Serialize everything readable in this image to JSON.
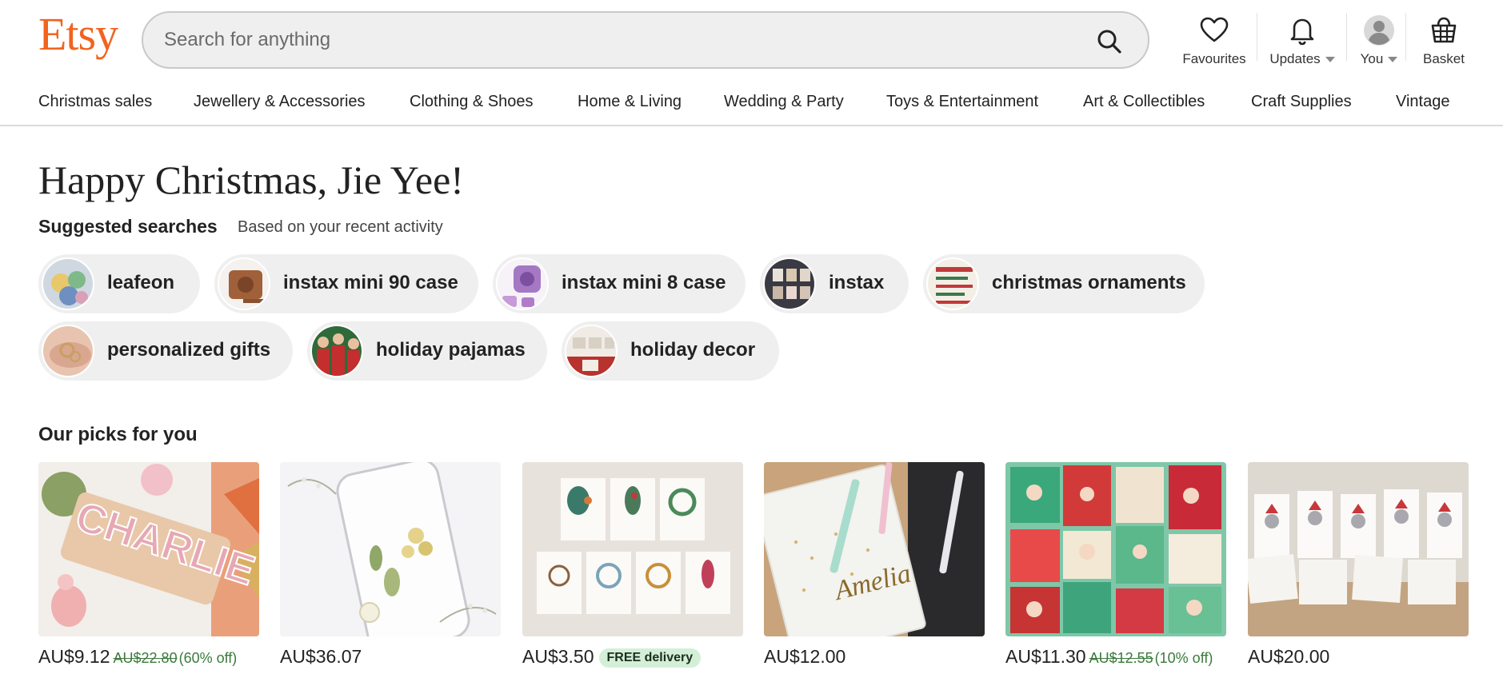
{
  "header": {
    "logo": "Etsy",
    "search_placeholder": "Search for anything",
    "favourites_label": "Favourites",
    "updates_label": "Updates",
    "you_label": "You",
    "basket_label": "Basket"
  },
  "categories": [
    "Christmas sales",
    "Jewellery & Accessories",
    "Clothing & Shoes",
    "Home & Living",
    "Wedding & Party",
    "Toys & Entertainment",
    "Art & Collectibles",
    "Craft Supplies",
    "Vintage"
  ],
  "greeting": "Happy Christmas, Jie Yee!",
  "suggested": {
    "title": "Suggested searches",
    "subtitle": "Based on your recent activity",
    "chips": [
      "leafeon",
      "instax mini 90 case",
      "instax mini 8 case",
      "instax",
      "christmas ornaments",
      "personalized gifts",
      "holiday pajamas",
      "holiday decor"
    ]
  },
  "picks": {
    "title": "Our picks for you",
    "items": [
      {
        "price": "AU$9.12",
        "was": "AU$22.80",
        "off": "(60% off)",
        "badge": ""
      },
      {
        "price": "AU$36.07",
        "was": "",
        "off": "",
        "badge": ""
      },
      {
        "price": "AU$3.50",
        "was": "",
        "off": "",
        "badge": "FREE delivery"
      },
      {
        "price": "AU$12.00",
        "was": "",
        "off": "",
        "badge": ""
      },
      {
        "price": "AU$11.30",
        "was": "AU$12.55",
        "off": "(10% off)",
        "badge": ""
      },
      {
        "price": "AU$20.00",
        "was": "",
        "off": "",
        "badge": ""
      }
    ]
  },
  "colors": {
    "brand": "#F1641E",
    "sale_green": "#3b7a3b",
    "badge_bg": "#d3efd8"
  }
}
